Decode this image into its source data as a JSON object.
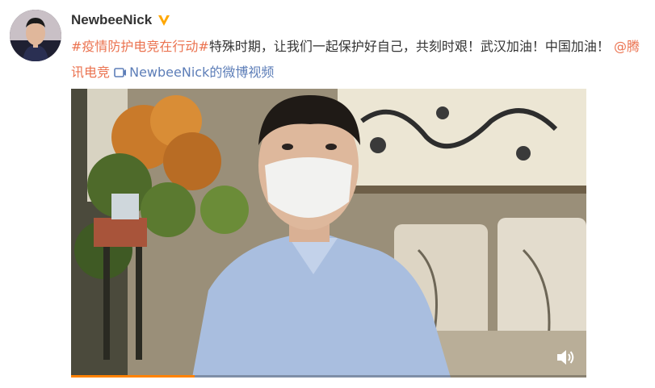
{
  "user": {
    "name": "NewbeeNick",
    "avatar_icon": "user-avatar",
    "verified_icon": "verified-badge-icon",
    "verified_color": "#ffa700"
  },
  "post": {
    "hashtag": "#疫情防护电竞在行动#",
    "body_text": "特殊时期，让我们一起保护好自己，共刻时艰！武汉加油！中国加油！",
    "mention": "@腾讯电竞",
    "video_link_prefix": "",
    "video_link_text": "NewbeeNick的微博视频",
    "link_color": "#eb7350",
    "video_link_color": "#5d7eb8"
  },
  "video": {
    "progress_percent": 24,
    "progress_color": "#ff8200",
    "volume_icon": "volume-icon"
  }
}
